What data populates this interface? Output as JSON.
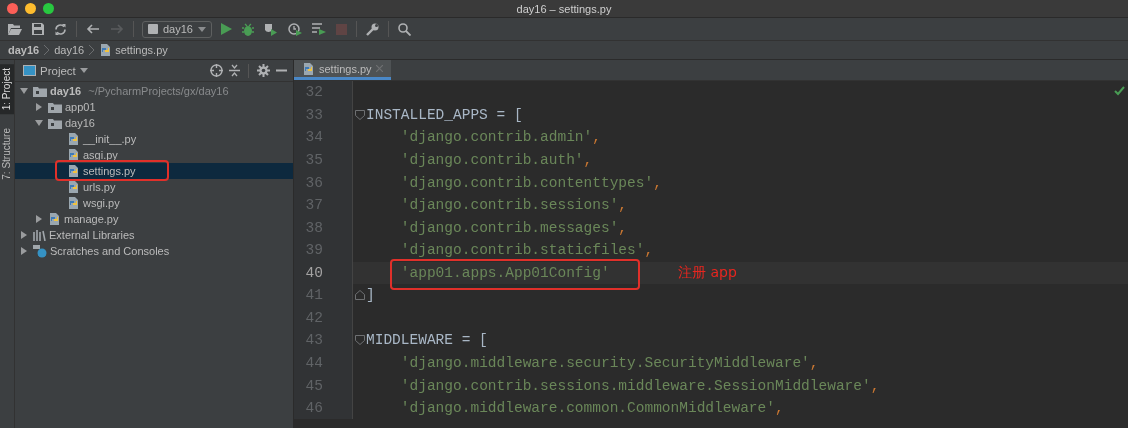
{
  "window": {
    "title": "day16 – settings.py"
  },
  "toolbar": {
    "buttons": [
      {
        "kind": "open",
        "disabled": false
      },
      {
        "kind": "save",
        "disabled": false
      },
      {
        "kind": "sync",
        "disabled": false
      },
      {
        "kind": "sep"
      },
      {
        "kind": "back",
        "disabled": false
      },
      {
        "kind": "forward",
        "disabled": true
      },
      {
        "kind": "sep"
      },
      {
        "kind": "config",
        "label": "day16"
      },
      {
        "kind": "run",
        "disabled": false
      },
      {
        "kind": "debug",
        "disabled": false
      },
      {
        "kind": "coverage",
        "disabled": false
      },
      {
        "kind": "profile",
        "disabled": false
      },
      {
        "kind": "concurrency",
        "disabled": false
      },
      {
        "kind": "stop",
        "disabled": true
      },
      {
        "kind": "sep"
      },
      {
        "kind": "wrench",
        "disabled": false
      },
      {
        "kind": "sep"
      },
      {
        "kind": "search",
        "disabled": false
      }
    ]
  },
  "breadcrumbs": [
    {
      "label": "day16",
      "kind": "project"
    },
    {
      "label": "day16",
      "kind": "folder"
    },
    {
      "label": "settings.py",
      "kind": "file"
    }
  ],
  "tool_strip": [
    {
      "label": "1: Project",
      "selected": true
    },
    {
      "label": "7: Structure",
      "selected": false
    }
  ],
  "project_panel": {
    "title": "Project",
    "tree": [
      {
        "label": "day16",
        "path": "~/PycharmProjects/gx/day16",
        "kind": "root",
        "expanded": true,
        "selected": false,
        "annotated": false,
        "children": [
          {
            "label": "app01",
            "kind": "folder",
            "expanded": false,
            "selected": false,
            "annotated": false
          },
          {
            "label": "day16",
            "kind": "folder",
            "expanded": true,
            "selected": false,
            "annotated": false,
            "children": [
              {
                "label": "__init__.py",
                "kind": "file",
                "selected": false,
                "annotated": false
              },
              {
                "label": "asgi.py",
                "kind": "file",
                "selected": false,
                "annotated": false
              },
              {
                "label": "settings.py",
                "kind": "file",
                "selected": true,
                "annotated": true
              },
              {
                "label": "urls.py",
                "kind": "file",
                "selected": false,
                "annotated": false
              },
              {
                "label": "wsgi.py",
                "kind": "file",
                "selected": false,
                "annotated": false
              }
            ]
          },
          {
            "label": "manage.py",
            "kind": "file",
            "expanded": false,
            "selected": false,
            "annotated": false
          }
        ]
      },
      {
        "label": "External Libraries",
        "kind": "libraries",
        "expanded": false,
        "selected": false,
        "annotated": false
      },
      {
        "label": "Scratches and Consoles",
        "kind": "scratches",
        "expanded": false,
        "selected": false,
        "annotated": false
      }
    ]
  },
  "editor": {
    "tabs": [
      {
        "label": "settings.py",
        "selected": true
      }
    ],
    "lines": [
      {
        "number": "32",
        "current": false
      },
      {
        "number": "33",
        "code": "INSTALLED_APPS = [",
        "fold_start": true,
        "current": false
      },
      {
        "number": "34",
        "code": "    'django.contrib.admin',",
        "current": false
      },
      {
        "number": "35",
        "code": "    'django.contrib.auth',",
        "current": false
      },
      {
        "number": "36",
        "code": "    'django.contrib.contenttypes',",
        "current": false
      },
      {
        "number": "37",
        "code": "    'django.contrib.sessions',",
        "current": false
      },
      {
        "number": "38",
        "code": "    'django.contrib.messages',",
        "current": false
      },
      {
        "number": "39",
        "code": "    'django.contrib.staticfiles',",
        "current": false
      },
      {
        "number": "40",
        "code": "    'app01.apps.App01Config'",
        "current": true,
        "annotated": true,
        "note": "注册 app"
      },
      {
        "number": "41",
        "code": "]",
        "fold_end": true,
        "current": false
      },
      {
        "number": "42",
        "current": false
      },
      {
        "number": "43",
        "code": "MIDDLEWARE = [",
        "fold_start": true,
        "current": false
      },
      {
        "number": "44",
        "code": "    'django.middleware.security.SecurityMiddleware',",
        "current": false
      },
      {
        "number": "45",
        "code": "    'django.contrib.sessions.middleware.SessionMiddleware',",
        "current": false
      },
      {
        "number": "46",
        "code": "    'django.middleware.common.CommonMiddleware',",
        "current": false
      }
    ]
  }
}
